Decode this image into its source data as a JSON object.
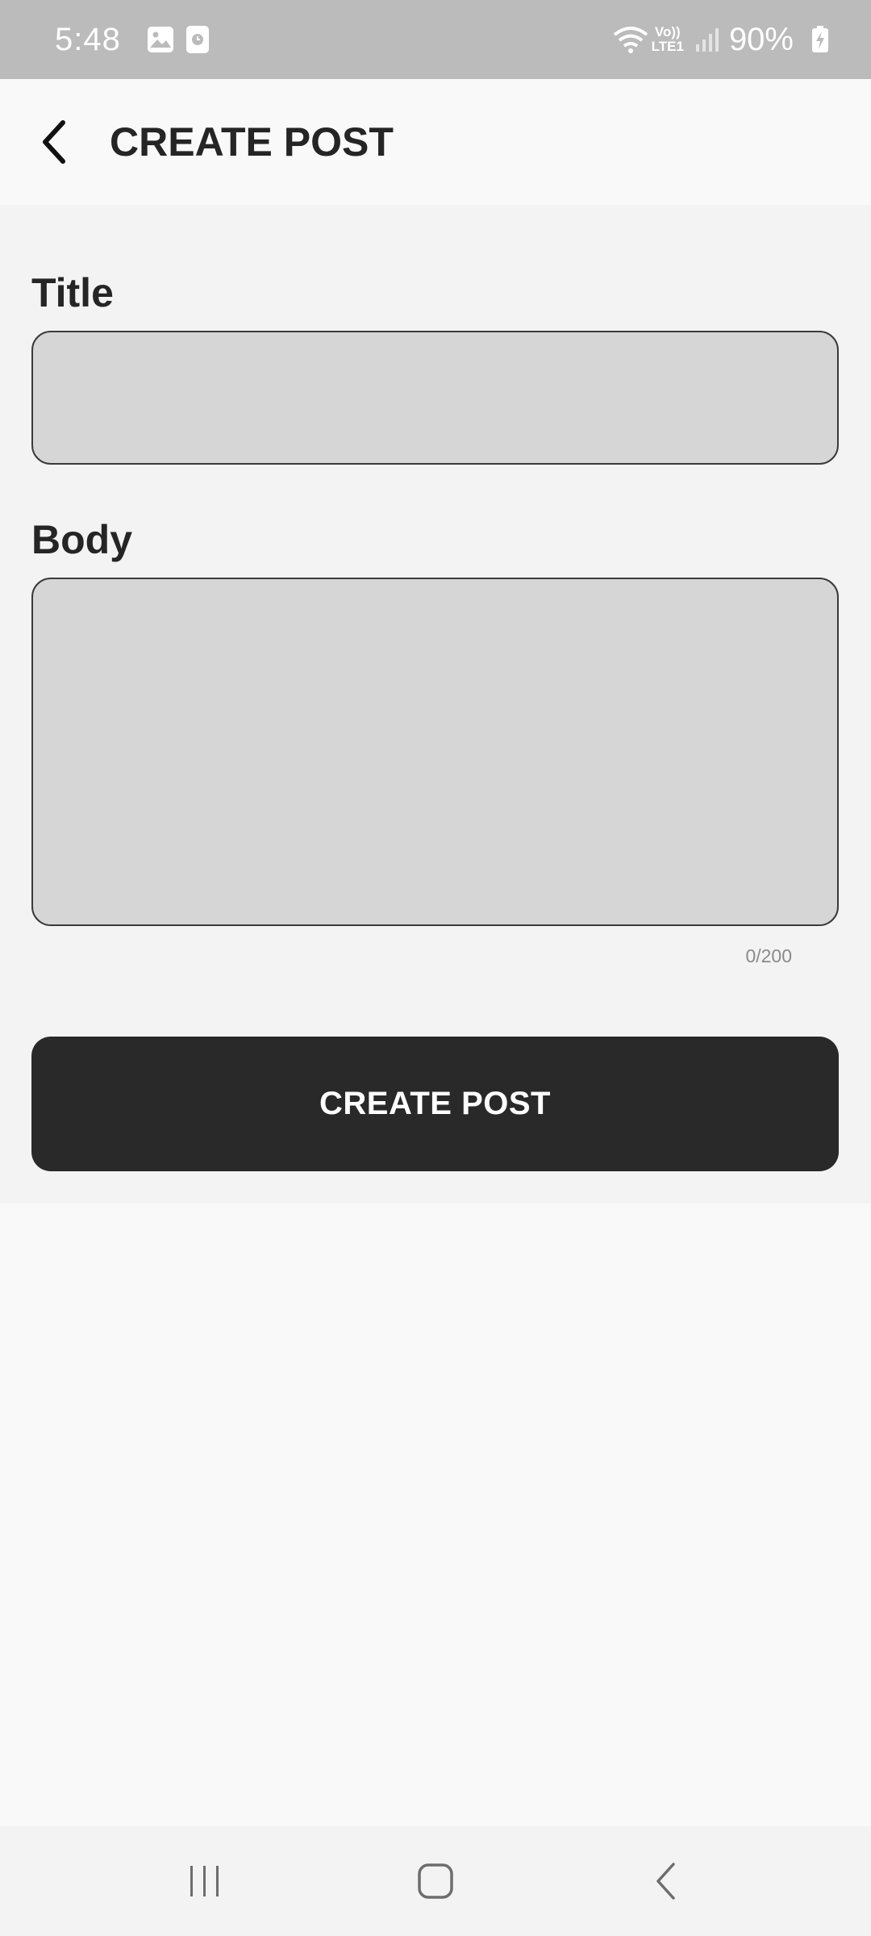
{
  "status_bar": {
    "time": "5:48",
    "left_icons": [
      "gallery-icon",
      "clock-notification-icon"
    ],
    "network_badge_top": "Vo))",
    "network_badge_bottom": "LTE1",
    "battery_percent": "90%",
    "right_icons": [
      "wifi-icon",
      "signal-icon",
      "battery-charging-icon"
    ]
  },
  "app_bar": {
    "back_icon": "chevron-left-icon",
    "title": "CREATE POST"
  },
  "form": {
    "title_label": "Title",
    "title_value": "",
    "body_label": "Body",
    "body_value": "",
    "char_counter": "0/200",
    "submit_label": "CREATE POST"
  },
  "nav_bar": {
    "items": [
      "recent-apps-icon",
      "home-icon",
      "back-icon"
    ]
  },
  "colors": {
    "status_bar_bg": "#bbbbbb",
    "page_bg": "#f9f9f9",
    "form_bg": "#f3f3f3",
    "input_bg": "#d6d6d6",
    "button_bg": "#292929",
    "text_primary": "#252525"
  }
}
